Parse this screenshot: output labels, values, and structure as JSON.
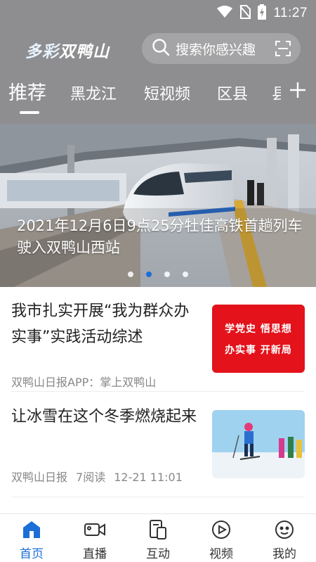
{
  "status_bar": {
    "time": "11:27"
  },
  "header": {
    "logo_part1": "多彩",
    "logo_part2": "双鸭山",
    "search_placeholder": "搜索你感兴趣"
  },
  "tabs": [
    "推荐",
    "黑龙江",
    "短视频",
    "区县",
    "县"
  ],
  "banner": {
    "caption": "2021年12月6日9点25分牡佳高铁首趟列车驶入双鸭山西站",
    "dot_count": 4,
    "active_dot": 1
  },
  "news": [
    {
      "title": "我市扎实开展“我为群众办实事”实践活动综述",
      "meta": [
        "双鸭山日报APP：掌上双鸭山"
      ],
      "thumb_lines": [
        "学党史 悟思想",
        "办实事 开新局"
      ]
    },
    {
      "title": "让冰雪在这个冬季燃烧起来",
      "meta": [
        "双鸭山日报",
        "7阅读",
        "12-21 11:01"
      ]
    }
  ],
  "bottom_nav": [
    {
      "label": "首页",
      "icon": "home-icon",
      "active": true
    },
    {
      "label": "直播",
      "icon": "video-camera-icon",
      "active": false
    },
    {
      "label": "互动",
      "icon": "interact-icon",
      "active": false
    },
    {
      "label": "视频",
      "icon": "play-icon",
      "active": false
    },
    {
      "label": "我的",
      "icon": "user-icon",
      "active": false
    }
  ],
  "colors": {
    "accent": "#1b6fd6",
    "header_bg": "#8e8e90",
    "red_badge": "#e3121b"
  }
}
